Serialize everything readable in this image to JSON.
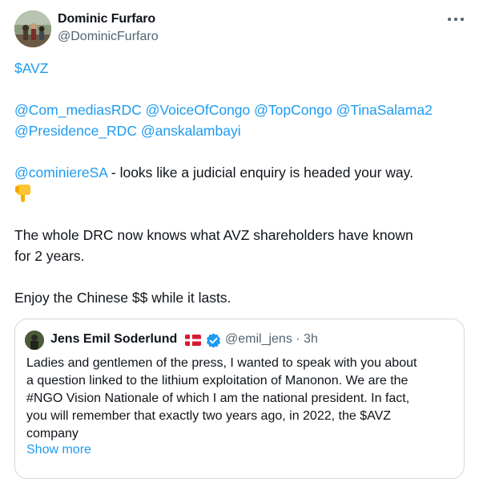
{
  "author": {
    "name": "Dominic Furfaro",
    "handle": "@DominicFurfaro"
  },
  "tweet": {
    "cashtag": "$AVZ",
    "mentions_line1": [
      "@Com_mediasRDC",
      "@VoiceOfCongo",
      "@TopCongo",
      "@TinaSalama2"
    ],
    "mentions_line2": [
      "@Presidence_RDC",
      "@anskalambayi"
    ],
    "reply_mention": "@cominiereSA",
    "reply_text": " - looks like a judicial enquiry is headed your way.",
    "emoji": "backhand-index-pointing-down-icon",
    "paragraph3_line1": "The whole DRC now knows what AVZ shareholders have known",
    "paragraph3_line2": "for 2 years.",
    "paragraph4": "Enjoy the Chinese $$ while it lasts."
  },
  "quoted_tweet": {
    "name": "Jens Emil Soderlund",
    "flag": "denmark-flag-icon",
    "handle_time": "@emil_jens · 3h",
    "lines": [
      "Ladies and gentlemen of the press, I wanted to speak with you about",
      "a question linked to the lithium exploitation of Manonon. We are the",
      "#NGO Vision Nationale of which I am the national president. In fact,",
      "you will remember that exactly two years ago, in 2022, the $AVZ",
      "company"
    ],
    "show_more": "Show more"
  },
  "colors": {
    "link": "#1d9bf0",
    "text": "#0f1419",
    "secondary": "#536471",
    "border": "#cfd9de"
  }
}
